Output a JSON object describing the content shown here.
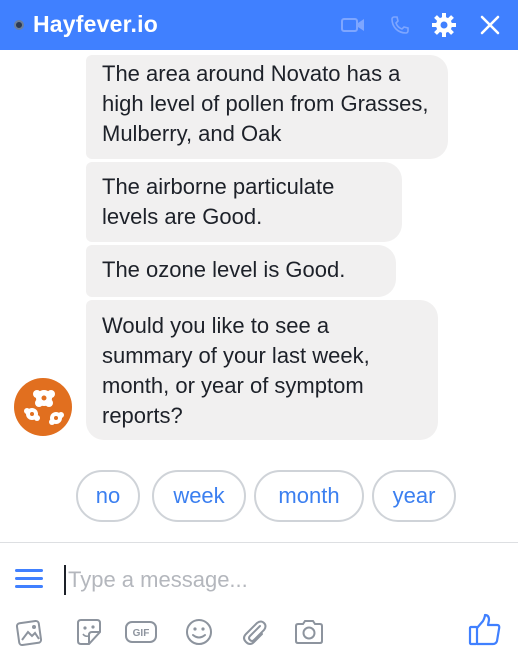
{
  "header": {
    "title": "Hayfever.io",
    "icons": [
      "status-dot",
      "video-icon",
      "phone-icon",
      "gear-icon",
      "close-icon"
    ],
    "brand_color": "#4080ff"
  },
  "messages": [
    {
      "text": "The area around Novato has a high level of pollen from Grasses, Mulberry, and Oak"
    },
    {
      "text": "The airborne particulate levels are Good."
    },
    {
      "text": "The ozone level is Good."
    },
    {
      "text": "Would you like to see a summary of your last week, month, or year of symptom reports?"
    }
  ],
  "quick_replies": [
    "no",
    "week",
    "month",
    "year"
  ],
  "composer": {
    "placeholder": "Type a message...",
    "value": "",
    "icons": [
      "menu-icon",
      "photo-icon",
      "sticker-icon",
      "gif-icon",
      "emoji-icon",
      "attach-icon",
      "camera-icon",
      "like-icon"
    ],
    "gif_label": "GIF"
  },
  "colors": {
    "accent": "#4080ff",
    "bubble": "#f1f0f0",
    "avatar": "#e16f1f",
    "quick_reply_text": "#3b7ff0"
  }
}
